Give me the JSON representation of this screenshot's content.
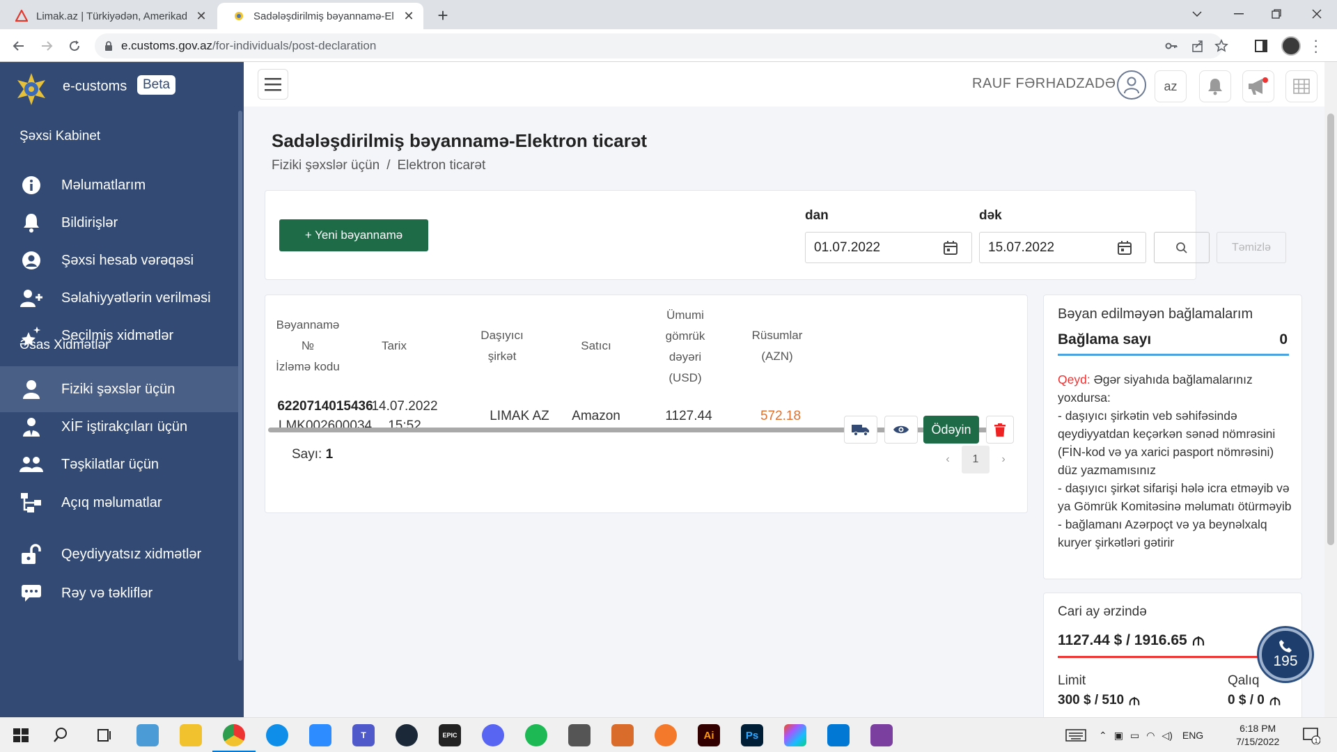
{
  "browser": {
    "tabs": [
      {
        "title": "Limak.az | Türkiyədən, Amerikadan",
        "active": false
      },
      {
        "title": "Sadələşdirilmiş bəyannamə-Elektron",
        "active": true
      }
    ],
    "url_host": "e.customs.gov.az",
    "url_path": "/for-individuals/post-declaration"
  },
  "sidebar": {
    "brand": "e-customs",
    "beta": "Beta",
    "section1": "Şəxsi Kabinet",
    "section2": "Əsas Xidmətlər",
    "items": [
      {
        "label": "Məlumatlarım",
        "icon": "info-icon"
      },
      {
        "label": "Bildirişlər",
        "icon": "bell-icon"
      },
      {
        "label": "Şəxsi hesab vərəqəsi",
        "icon": "user-circle-icon"
      },
      {
        "label": "Səlahiyyətlərin verilməsi",
        "icon": "user-plus-icon"
      },
      {
        "label": "Seçilmiş xidmətlər",
        "icon": "stars-icon"
      },
      {
        "label": "Fiziki şəxslər üçün",
        "icon": "user-icon",
        "active": true
      },
      {
        "label": "XİF iştirakçıları üçün",
        "icon": "user-tie-icon"
      },
      {
        "label": "Təşkilatlar üçün",
        "icon": "users-icon"
      },
      {
        "label": "Açıq məlumatlar",
        "icon": "sitemap-icon"
      },
      {
        "label": "Qeydiyyatsız xidmətlər",
        "icon": "unlock-icon"
      },
      {
        "label": "Rəy və təkliflər",
        "icon": "comment-icon"
      }
    ]
  },
  "header": {
    "username": "RAUF FƏRHADZADƏ",
    "lang": "az"
  },
  "page": {
    "title": "Sadələşdirilmiş bəyannamə-Elektron ticarət",
    "breadcrumb": [
      "Fiziki şəxslər üçün",
      "Elektron ticarət"
    ]
  },
  "filter": {
    "new_button": "+ Yeni bəyannamə",
    "from_label": "dan",
    "from_value": "01.07.2022",
    "to_label": "dək",
    "to_value": "15.07.2022",
    "clear_label": "Təmizlə"
  },
  "table": {
    "headers": {
      "decl": [
        "Bəyannamə",
        "№",
        "İzləmə kodu"
      ],
      "date": "Tarix",
      "carrier": [
        "Daşıyıcı",
        "şirkət"
      ],
      "seller": "Satıcı",
      "value": [
        "Ümumi",
        "gömrük",
        "dəyəri",
        "(USD)"
      ],
      "duty": [
        "Rüsumlar",
        "(AZN)"
      ]
    },
    "rows": [
      {
        "decl_no": "6220714015436",
        "tracking": "LMK002600034",
        "date": "14.07.2022",
        "time": "15:52",
        "carrier": "LIMAK AZ",
        "seller": "Amazon",
        "value": "1127.44",
        "duty": "572.18",
        "pay_label": "Ödəyin"
      }
    ],
    "count_label": "Sayı:",
    "count": "1",
    "page": "1"
  },
  "undeclared": {
    "title": "Bəyan edilməyən bağlamalarım",
    "count_label": "Bağlama sayı",
    "count": "0",
    "note_prefix": "Qeyd:",
    "note_lines": [
      " Əgər siyahıda bağlamalarınız yoxdursa:",
      "- daşıyıcı şirkətin veb səhifəsində qeydiyyatdan keçərkən sənəd nömrəsini (FİN-kod və ya xarici pasport nömrəsini) düz yazmamısınız",
      "- daşıyıcı şirkət sifarişi hələ icra etməyib və ya Gömrük Komitəsinə məlumatı ötürməyib",
      "- bağlamanı Azərpoçt və ya beynəlxalq kuryer şirkətləri gətirir"
    ]
  },
  "monthly": {
    "title": "Cari ay ərzində",
    "value": "1127.44 $ / 1916.65",
    "limit_label": "Limit",
    "limit_value": "300 $ / 510",
    "remain_label": "Qalıq",
    "remain_value": "0 $ / 0"
  },
  "call_center": "195",
  "taskbar": {
    "lang": "ENG",
    "time": "6:18 PM",
    "date": "7/15/2022",
    "notif_count": "1"
  },
  "colors": {
    "sidebar": "#324a74",
    "primary_green": "#1d6b47",
    "duty_orange": "#e2702e",
    "alert_red": "#e33"
  }
}
